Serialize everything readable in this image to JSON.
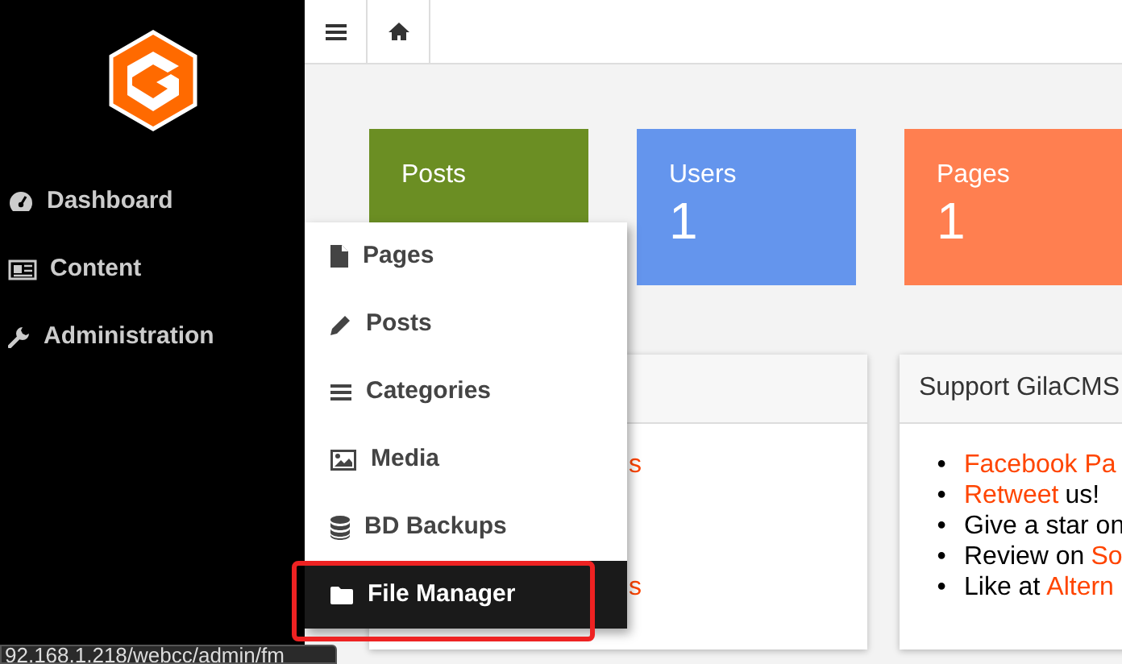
{
  "sidebar": {
    "items": [
      {
        "label": "Dashboard"
      },
      {
        "label": "Content"
      },
      {
        "label": "Administration"
      }
    ]
  },
  "stats": [
    {
      "label": "Posts",
      "color": "#6b8e23"
    },
    {
      "label": "Users",
      "value": "1",
      "color": "#6495ed"
    },
    {
      "label": "Pages",
      "value": "1",
      "color": "#ff7f50"
    }
  ],
  "left_panel": {
    "rows": [
      "s",
      "",
      "",
      "",
      "s"
    ]
  },
  "support_panel": {
    "title": "Support GilaCMS",
    "items": [
      {
        "marker": "•",
        "parts": [
          {
            "text": "Facebook Pa",
            "link": true
          }
        ]
      },
      {
        "marker": "•",
        "parts": [
          {
            "text": "Retweet",
            "link": true
          },
          {
            "text": "us!",
            "link": false
          }
        ]
      },
      {
        "marker": "•",
        "parts": [
          {
            "text": "Give a star on",
            "link": false
          }
        ]
      },
      {
        "marker": "•",
        "parts": [
          {
            "text": "Review on",
            "link": false
          },
          {
            "text": "So",
            "link": true
          }
        ]
      },
      {
        "marker": "•",
        "parts": [
          {
            "text": "Like at",
            "link": false
          },
          {
            "text": "Altern",
            "link": true
          }
        ]
      }
    ]
  },
  "dropdown": {
    "items": [
      {
        "label": "Pages",
        "selected": false
      },
      {
        "label": "Posts",
        "selected": false
      },
      {
        "label": "Categories",
        "selected": false
      },
      {
        "label": "Media",
        "selected": false
      },
      {
        "label": "BD Backups",
        "selected": false
      },
      {
        "label": "File Manager",
        "selected": true
      }
    ]
  },
  "status_url": "92.168.1.218/webcc/admin/fm"
}
